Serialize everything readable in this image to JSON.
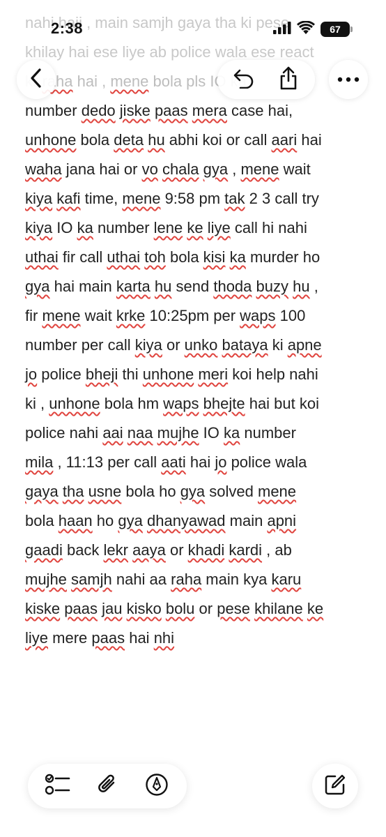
{
  "status_bar": {
    "time": "2:38",
    "battery_level": "67",
    "icons": [
      "signal-bars-icon",
      "wifi-icon",
      "battery-icon"
    ]
  },
  "faded_top_lines": [
    "nahi haii , main samjh gaya tha ki pese",
    "khilay hai ese liye ab police wala ese react"
  ],
  "toolbar": {
    "icons": [
      "chevron-left-icon",
      "undo-icon",
      "share-icon",
      "more-icon"
    ]
  },
  "note": {
    "lines": [
      [
        {
          "t": "kr "
        },
        {
          "t": "raha",
          "s": true
        },
        {
          "t": " hai , "
        },
        {
          "t": "mene",
          "s": true
        },
        {
          "t": " bola pls IO ka"
        }
      ],
      [
        {
          "t": "number "
        },
        {
          "t": "dedo",
          "s": true
        },
        {
          "t": " "
        },
        {
          "t": "jiske",
          "s": true
        },
        {
          "t": " "
        },
        {
          "t": "paas",
          "s": true
        },
        {
          "t": " "
        },
        {
          "t": "mera",
          "s": true
        },
        {
          "t": " case hai,"
        }
      ],
      [
        {
          "t": "unhone",
          "s": true
        },
        {
          "t": " bola "
        },
        {
          "t": "deta",
          "s": true
        },
        {
          "t": " "
        },
        {
          "t": "hu",
          "s": true
        },
        {
          "t": " abhi koi or call "
        },
        {
          "t": "aari",
          "s": true
        },
        {
          "t": " hai"
        }
      ],
      [
        {
          "t": "waha",
          "s": true
        },
        {
          "t": " jana hai or "
        },
        {
          "t": "vo",
          "s": true
        },
        {
          "t": " "
        },
        {
          "t": "chala",
          "s": true
        },
        {
          "t": " "
        },
        {
          "t": "gya",
          "s": true
        },
        {
          "t": " , "
        },
        {
          "t": "mene",
          "s": true
        },
        {
          "t": " wait"
        }
      ],
      [
        {
          "t": "kiya",
          "s": true
        },
        {
          "t": " "
        },
        {
          "t": "kafi",
          "s": true
        },
        {
          "t": " time, "
        },
        {
          "t": "mene",
          "s": true
        },
        {
          "t": " 9:58 pm "
        },
        {
          "t": "tak",
          "s": true
        },
        {
          "t": " 2 3 call try"
        }
      ],
      [
        {
          "t": "kiya",
          "s": true
        },
        {
          "t": " IO "
        },
        {
          "t": "ka",
          "s": true
        },
        {
          "t": " number "
        },
        {
          "t": "lene",
          "s": true
        },
        {
          "t": " "
        },
        {
          "t": "ke",
          "s": true
        },
        {
          "t": " "
        },
        {
          "t": "liye",
          "s": true
        },
        {
          "t": " call hi nahi"
        }
      ],
      [
        {
          "t": "uthai",
          "s": true
        },
        {
          "t": " fir call "
        },
        {
          "t": "uthai",
          "s": true
        },
        {
          "t": " "
        },
        {
          "t": "toh",
          "s": true
        },
        {
          "t": " bola "
        },
        {
          "t": "kisi",
          "s": true
        },
        {
          "t": " "
        },
        {
          "t": "ka",
          "s": true
        },
        {
          "t": " murder ho"
        }
      ],
      [
        {
          "t": "gya",
          "s": true
        },
        {
          "t": " hai main "
        },
        {
          "t": "karta",
          "s": true
        },
        {
          "t": " "
        },
        {
          "t": "hu",
          "s": true
        },
        {
          "t": " send "
        },
        {
          "t": "thoda",
          "s": true
        },
        {
          "t": " "
        },
        {
          "t": "buzy",
          "s": true
        },
        {
          "t": " "
        },
        {
          "t": "hu",
          "s": true
        },
        {
          "t": " ,"
        }
      ],
      [
        {
          "t": "fir "
        },
        {
          "t": "mene",
          "s": true
        },
        {
          "t": " wait "
        },
        {
          "t": "krke",
          "s": true
        },
        {
          "t": " 10:25pm per "
        },
        {
          "t": "waps",
          "s": true
        },
        {
          "t": " 100"
        }
      ],
      [
        {
          "t": "number per call "
        },
        {
          "t": "kiya",
          "s": true
        },
        {
          "t": " or "
        },
        {
          "t": "unko",
          "s": true
        },
        {
          "t": " "
        },
        {
          "t": "bataya",
          "s": true
        },
        {
          "t": " ki "
        },
        {
          "t": "apne",
          "s": true
        }
      ],
      [
        {
          "t": "jo",
          "s": true
        },
        {
          "t": " police "
        },
        {
          "t": "bheji",
          "s": true
        },
        {
          "t": " thi "
        },
        {
          "t": "unhone",
          "s": true
        },
        {
          "t": " "
        },
        {
          "t": "meri",
          "s": true
        },
        {
          "t": " koi help nahi"
        }
      ],
      [
        {
          "t": "ki , "
        },
        {
          "t": "unhone",
          "s": true
        },
        {
          "t": " bola hm "
        },
        {
          "t": "waps",
          "s": true
        },
        {
          "t": " "
        },
        {
          "t": "bhejte",
          "s": true
        },
        {
          "t": " hai but koi"
        }
      ],
      [
        {
          "t": "police nahi "
        },
        {
          "t": "aai",
          "s": true
        },
        {
          "t": " "
        },
        {
          "t": "naa",
          "s": true
        },
        {
          "t": " "
        },
        {
          "t": "mujhe",
          "s": true
        },
        {
          "t": " IO "
        },
        {
          "t": "ka",
          "s": true
        },
        {
          "t": " number"
        }
      ],
      [
        {
          "t": "mila",
          "s": true
        },
        {
          "t": " , 11:13 per call "
        },
        {
          "t": "aati",
          "s": true
        },
        {
          "t": " hai "
        },
        {
          "t": "jo",
          "s": true
        },
        {
          "t": " police wala"
        }
      ],
      [
        {
          "t": "gaya",
          "s": true
        },
        {
          "t": " "
        },
        {
          "t": "tha",
          "s": true
        },
        {
          "t": " "
        },
        {
          "t": "usne",
          "s": true
        },
        {
          "t": " bola ho "
        },
        {
          "t": "gya",
          "s": true
        },
        {
          "t": " solved "
        },
        {
          "t": "mene",
          "s": true
        }
      ],
      [
        {
          "t": "bola "
        },
        {
          "t": "haan",
          "s": true
        },
        {
          "t": " ho "
        },
        {
          "t": "gya",
          "s": true
        },
        {
          "t": " "
        },
        {
          "t": "dhanyawad",
          "s": true
        },
        {
          "t": " main "
        },
        {
          "t": "apni",
          "s": true
        }
      ],
      [
        {
          "t": "gaadi",
          "s": true
        },
        {
          "t": " back "
        },
        {
          "t": "lekr",
          "s": true
        },
        {
          "t": " "
        },
        {
          "t": "aaya",
          "s": true
        },
        {
          "t": " or "
        },
        {
          "t": "khadi",
          "s": true
        },
        {
          "t": " "
        },
        {
          "t": "kardi",
          "s": true
        },
        {
          "t": " , ab"
        }
      ],
      [
        {
          "t": "mujhe",
          "s": true
        },
        {
          "t": " "
        },
        {
          "t": "samjh",
          "s": true
        },
        {
          "t": " nahi aa "
        },
        {
          "t": "raha",
          "s": true
        },
        {
          "t": " main kya "
        },
        {
          "t": "karu",
          "s": true
        }
      ],
      [
        {
          "t": "kiske",
          "s": true
        },
        {
          "t": " "
        },
        {
          "t": "paas",
          "s": true
        },
        {
          "t": " "
        },
        {
          "t": "jau",
          "s": true
        },
        {
          "t": " "
        },
        {
          "t": "kisko",
          "s": true
        },
        {
          "t": " "
        },
        {
          "t": "bolu",
          "s": true
        },
        {
          "t": " or "
        },
        {
          "t": "pese",
          "s": true
        },
        {
          "t": " "
        },
        {
          "t": "khilane",
          "s": true
        },
        {
          "t": " "
        },
        {
          "t": "ke",
          "s": true
        }
      ],
      [
        {
          "t": "liye",
          "s": true
        },
        {
          "t": " mere "
        },
        {
          "t": "paas",
          "s": true
        },
        {
          "t": " hai "
        },
        {
          "t": "nhi",
          "s": true
        }
      ]
    ]
  },
  "bottom_toolbar": {
    "icons": [
      "checklist-icon",
      "paperclip-icon",
      "markup-pen-icon",
      "compose-icon"
    ]
  },
  "colors": {
    "spellcheck_underline": "#e0443e",
    "text": "#222222",
    "faded_text": "#c8c8c8"
  }
}
